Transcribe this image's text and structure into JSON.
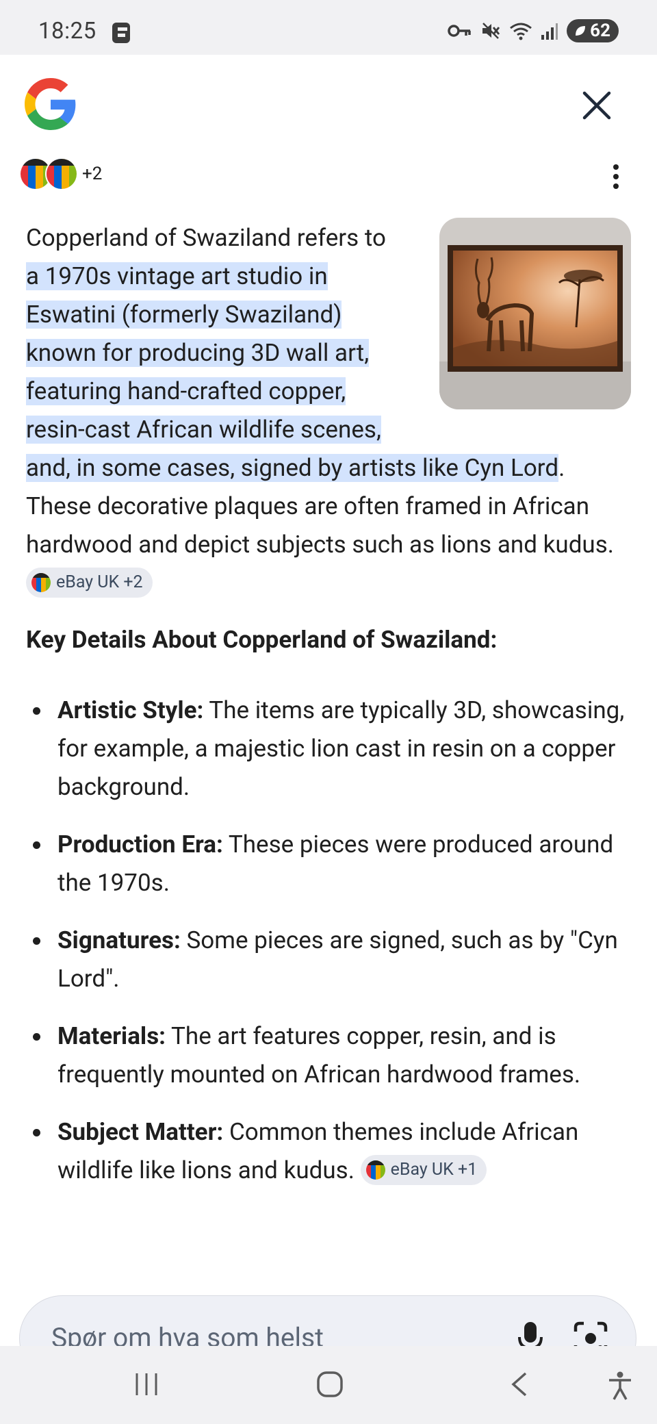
{
  "status_bar": {
    "time": "18:25",
    "icons": [
      "f-notification-icon",
      "key-icon",
      "mute-icon",
      "wifi-icon",
      "signal-icon"
    ],
    "battery": "62"
  },
  "header": {
    "logo": "google-logo",
    "close_icon": "close-icon",
    "sources_more": "+2",
    "menu_icon": "more-vertical-icon"
  },
  "answer": {
    "intro_plain": "Copperland of Swaziland refers to",
    "intro_highlight_1": " a 1970s vintage art studio in",
    "intro_highlight_2": "Eswatini (formerly Swaziland)",
    "intro_highlight_3": "known for producing 3D wall art,",
    "intro_highlight_4": "featuring hand-crafted copper,",
    "intro_highlight_5": "resin-cast African wildlife scenes,",
    "intro_highlight_6": "and, in some cases, signed by artists like Cyn Lord",
    "intro_end": ".",
    "intro_rest": "These decorative plaques are often framed in African hardwood and depict subjects such as lions and kudus.",
    "chip_1": "eBay UK +2"
  },
  "key_details": {
    "heading": "Key Details About Copperland of Swaziland:",
    "items": [
      {
        "label": "Artistic Style:",
        "text": " The items are typically 3D, showcasing, for example, a majestic lion cast in resin on a copper background."
      },
      {
        "label": "Production Era:",
        "text": " These pieces were produced around the 1970s."
      },
      {
        "label": "Signatures:",
        "text": " Some pieces are signed, such as by \"Cyn Lord\"."
      },
      {
        "label": "Materials:",
        "text": " The art features copper, resin, and is frequently mounted on African hardwood frames."
      },
      {
        "label": "Subject Matter:",
        "text": " Common themes include African wildlife like lions and kudus."
      }
    ],
    "chip_2": "eBay UK +1"
  },
  "search": {
    "placeholder": "Spør om hva som helst",
    "mic_icon": "microphone-icon",
    "lens_icon": "camera-lens-icon"
  },
  "navigation": {
    "icons": [
      "recent-apps-icon",
      "home-icon",
      "back-icon",
      "accessibility-icon"
    ]
  }
}
